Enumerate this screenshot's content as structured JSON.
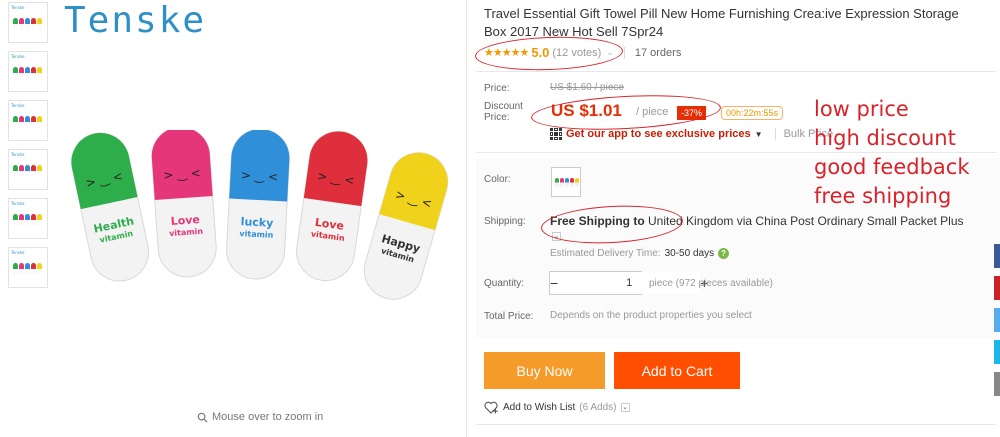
{
  "gallery": {
    "brand": "Tenske",
    "thumb_count": 6,
    "zoom_hint": "Mouse over to zoom in",
    "pills": [
      {
        "color": "#2eae4b",
        "line1": "Health",
        "line2": "vitamin"
      },
      {
        "color": "#e6367a",
        "line1": "Love",
        "line2": "vitamin"
      },
      {
        "color": "#2f8fd8",
        "line1": "lucky",
        "line2": "vitamin"
      },
      {
        "color": "#e02f3c",
        "line1": "Love",
        "line2": "vitamin"
      },
      {
        "color": "#f0d21a",
        "line1": "Happy",
        "line2": "vitamin"
      }
    ]
  },
  "product": {
    "title": "Travel Essential Gift Towel Pill New Home Furnishing Crea:ive Expression Storage Box 2017 New Hot Sell 7Spr24",
    "rating": {
      "stars": "★★★★★",
      "value": "5.0",
      "votes": "(12 votes)",
      "orders": "17 orders"
    },
    "price": {
      "label": "Price:",
      "original": "US $1.60 / piece",
      "discount_label": "Discount Price:",
      "discount_price": "US $1.01",
      "per_piece": "/ piece",
      "discount_pct": "-37%",
      "countdown": "00h:22m:55s"
    },
    "app_promo": {
      "text": "Get our app to see exclusive prices",
      "bulk": "Bulk Price"
    },
    "color": {
      "label": "Color:"
    },
    "shipping": {
      "label": "Shipping:",
      "highlight": "Free Shipping to",
      "rest": "United Kingdom via China Post Ordinary Small Packet Plus",
      "delivery_label": "Estimated Delivery Time:",
      "delivery_days": "30-50 days"
    },
    "quantity": {
      "label": "Quantity:",
      "minus": "−",
      "value": "1",
      "plus": "+",
      "available": "piece (972 pieces available)"
    },
    "total": {
      "label": "Total Price:",
      "value": "Depends on the product properties you select"
    },
    "buttons": {
      "buy_now": "Buy Now",
      "add_to_cart": "Add to Cart"
    },
    "wishlist": {
      "label": "Add to Wish List",
      "adds": "(6 Adds)"
    }
  },
  "annotations": {
    "color": "#d8232a",
    "notes": [
      "low price",
      "high discount",
      "good feedback",
      "free shipping"
    ]
  },
  "share_rail_colors": [
    "#3b5998",
    "#cb2027",
    "#55acee",
    "#1ab7ea",
    "#888888"
  ]
}
